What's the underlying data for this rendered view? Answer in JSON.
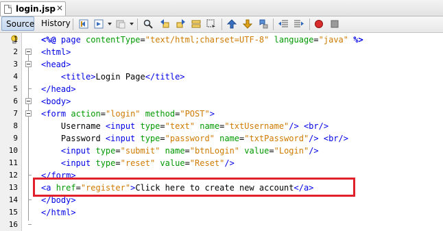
{
  "tab": {
    "title": "login.jsp",
    "close": "✕"
  },
  "toolbar": {
    "source_label": "Source",
    "history_label": "History",
    "icons": [
      "back-icon",
      "forward-dropdown-icon",
      "history-dropdown-icon",
      "find-icon",
      "find-previous-icon",
      "find-next-icon",
      "find-selection-icon",
      "toggle-highlight-icon",
      "prev-bookmark-icon",
      "next-bookmark-icon",
      "toggle-bookmark-icon",
      "shift-left-icon",
      "shift-right-icon",
      "record-macro-icon",
      "stop-macro-icon"
    ]
  },
  "editor": {
    "line_numbers": [
      "1",
      "2",
      "3",
      "4",
      "5",
      "6",
      "7",
      "8",
      "9",
      "10",
      "11",
      "12",
      "13",
      "14",
      "15",
      "16"
    ],
    "lines": [
      [
        {
          "c": "d",
          "s": "<%@"
        },
        {
          "c": "t",
          "s": " page "
        },
        {
          "c": "a",
          "s": "contentType"
        },
        {
          "c": "txt",
          "s": "="
        },
        {
          "c": "v",
          "s": "\"text/html;charset=UTF-8\""
        },
        {
          "c": "a",
          "s": " language"
        },
        {
          "c": "txt",
          "s": "="
        },
        {
          "c": "v",
          "s": "\"java\""
        },
        {
          "c": "d",
          "s": " %>"
        }
      ],
      [
        {
          "c": "t",
          "s": "<html>"
        }
      ],
      [
        {
          "c": "t",
          "s": "<head>"
        }
      ],
      [
        {
          "c": "txt",
          "s": "    "
        },
        {
          "c": "t",
          "s": "<title>"
        },
        {
          "c": "txt",
          "s": "Login Page"
        },
        {
          "c": "t",
          "s": "</title>"
        }
      ],
      [
        {
          "c": "t",
          "s": "</head>"
        }
      ],
      [
        {
          "c": "t",
          "s": "<body>"
        }
      ],
      [
        {
          "c": "t",
          "s": "<form "
        },
        {
          "c": "a",
          "s": "action"
        },
        {
          "c": "txt",
          "s": "="
        },
        {
          "c": "v",
          "s": "\"login\""
        },
        {
          "c": "a",
          "s": " method"
        },
        {
          "c": "txt",
          "s": "="
        },
        {
          "c": "v",
          "s": "\"POST\""
        },
        {
          "c": "t",
          "s": ">"
        }
      ],
      [
        {
          "c": "txt",
          "s": "    Username "
        },
        {
          "c": "t",
          "s": "<input "
        },
        {
          "c": "a",
          "s": "type"
        },
        {
          "c": "txt",
          "s": "="
        },
        {
          "c": "v",
          "s": "\"text\""
        },
        {
          "c": "a",
          "s": " name"
        },
        {
          "c": "txt",
          "s": "="
        },
        {
          "c": "v",
          "s": "\"txtUsername\""
        },
        {
          "c": "t",
          "s": "/> <br/>"
        }
      ],
      [
        {
          "c": "txt",
          "s": "    Password "
        },
        {
          "c": "t",
          "s": "<input "
        },
        {
          "c": "a",
          "s": "type"
        },
        {
          "c": "txt",
          "s": "="
        },
        {
          "c": "v",
          "s": "\"password\""
        },
        {
          "c": "a",
          "s": " name"
        },
        {
          "c": "txt",
          "s": "="
        },
        {
          "c": "v",
          "s": "\"txtPassword\""
        },
        {
          "c": "t",
          "s": "/> <br/>"
        }
      ],
      [
        {
          "c": "txt",
          "s": "    "
        },
        {
          "c": "t",
          "s": "<input "
        },
        {
          "c": "a",
          "s": "type"
        },
        {
          "c": "txt",
          "s": "="
        },
        {
          "c": "v",
          "s": "\"submit\""
        },
        {
          "c": "a",
          "s": " name"
        },
        {
          "c": "txt",
          "s": "="
        },
        {
          "c": "v",
          "s": "\"btnLogin\""
        },
        {
          "c": "a",
          "s": " value"
        },
        {
          "c": "txt",
          "s": "="
        },
        {
          "c": "v",
          "s": "\"Login\""
        },
        {
          "c": "t",
          "s": "/>"
        }
      ],
      [
        {
          "c": "txt",
          "s": "    "
        },
        {
          "c": "t",
          "s": "<input "
        },
        {
          "c": "a",
          "s": "type"
        },
        {
          "c": "txt",
          "s": "="
        },
        {
          "c": "v",
          "s": "\"reset\""
        },
        {
          "c": "a",
          "s": " value"
        },
        {
          "c": "txt",
          "s": "="
        },
        {
          "c": "v",
          "s": "\"Reset\""
        },
        {
          "c": "t",
          "s": "/>"
        }
      ],
      [
        {
          "c": "t",
          "s": "</form>"
        }
      ],
      [
        {
          "c": "t",
          "s": "<a "
        },
        {
          "c": "a",
          "s": "href"
        },
        {
          "c": "txt",
          "s": "="
        },
        {
          "c": "v",
          "s": "\"register\""
        },
        {
          "c": "t",
          "s": ">"
        },
        {
          "c": "txt",
          "s": "Click here to create new account"
        },
        {
          "c": "t",
          "s": "</a>"
        }
      ],
      [
        {
          "c": "t",
          "s": "</body>"
        }
      ],
      [
        {
          "c": "t",
          "s": "</html>"
        }
      ],
      []
    ]
  },
  "colors": {
    "tag": "#0000e6",
    "attribute": "#009900",
    "value": "#ce7b00",
    "highlight": "#e0202a"
  }
}
